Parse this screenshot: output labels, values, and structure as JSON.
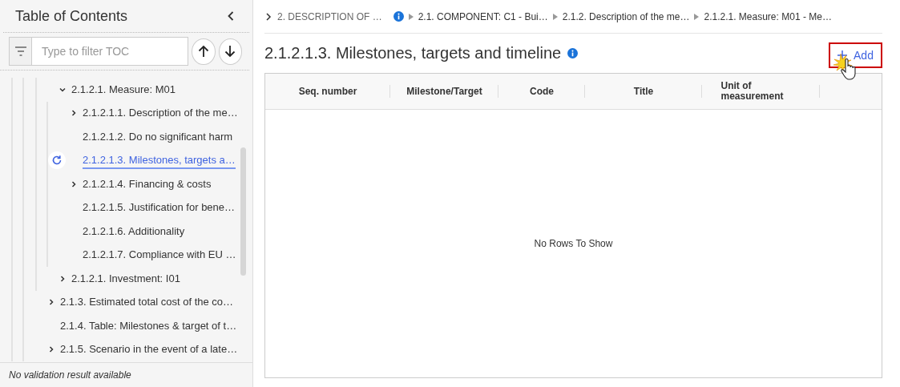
{
  "sidebar": {
    "title": "Table of Contents",
    "filter": {
      "placeholder": "Type to filter TOC"
    },
    "items": [
      {
        "children": [
          {
            "label": "2.1.2.1. Measure: M01",
            "kind": "branch",
            "expanded": true,
            "selected": false,
            "children": [
              {
                "label": "2.1.2.1.1. Description of the me…",
                "kind": "branch",
                "expanded": false,
                "selected": false
              },
              {
                "label": "2.1.2.1.2. Do no significant harm",
                "kind": "leaf",
                "selected": false
              },
              {
                "label": "2.1.2.1.3. Milestones, targets a…",
                "kind": "leaf",
                "selected": true
              },
              {
                "label": "2.1.2.1.4. Financing & costs",
                "kind": "branch",
                "expanded": false,
                "selected": false
              },
              {
                "label": "2.1.2.1.5. Justification for bene…",
                "kind": "leaf",
                "selected": false
              },
              {
                "label": "2.1.2.1.6. Additionality",
                "kind": "leaf",
                "selected": false
              },
              {
                "label": "2.1.2.1.7. Compliance with EU …",
                "kind": "leaf",
                "selected": false
              }
            ]
          },
          {
            "label": "2.1.2.1. Investment: I01",
            "kind": "branch",
            "expanded": false,
            "selected": false
          }
        ]
      },
      {
        "label": "2.1.3. Estimated total cost of the co…",
        "kind": "branch",
        "expanded": false,
        "selected": false
      },
      {
        "label": "2.1.4. Table: Milestones & target of t…",
        "kind": "leaf",
        "selected": false
      },
      {
        "label": "2.1.5. Scenario in the event of a late…",
        "kind": "branch",
        "expanded": false,
        "selected": false
      }
    ],
    "status": "No validation result available"
  },
  "breadcrumb": [
    {
      "label": "2. DESCRIPTION OF …",
      "info": true
    },
    {
      "label": "2.1. COMPONENT: C1 - Bui…",
      "info": false
    },
    {
      "label": "2.1.2. Description of the me…",
      "info": false
    },
    {
      "label": "2.1.2.1. Measure: M01 - Me…",
      "info": false
    }
  ],
  "section": {
    "title": "2.1.2.1.3. Milestones, targets and timeline",
    "add_button": "Add",
    "table": {
      "columns": [
        "Seq. number",
        "Milestone/Target",
        "Code",
        "Title",
        "Unit of measurement"
      ],
      "empty_message": "No Rows To Show"
    }
  }
}
